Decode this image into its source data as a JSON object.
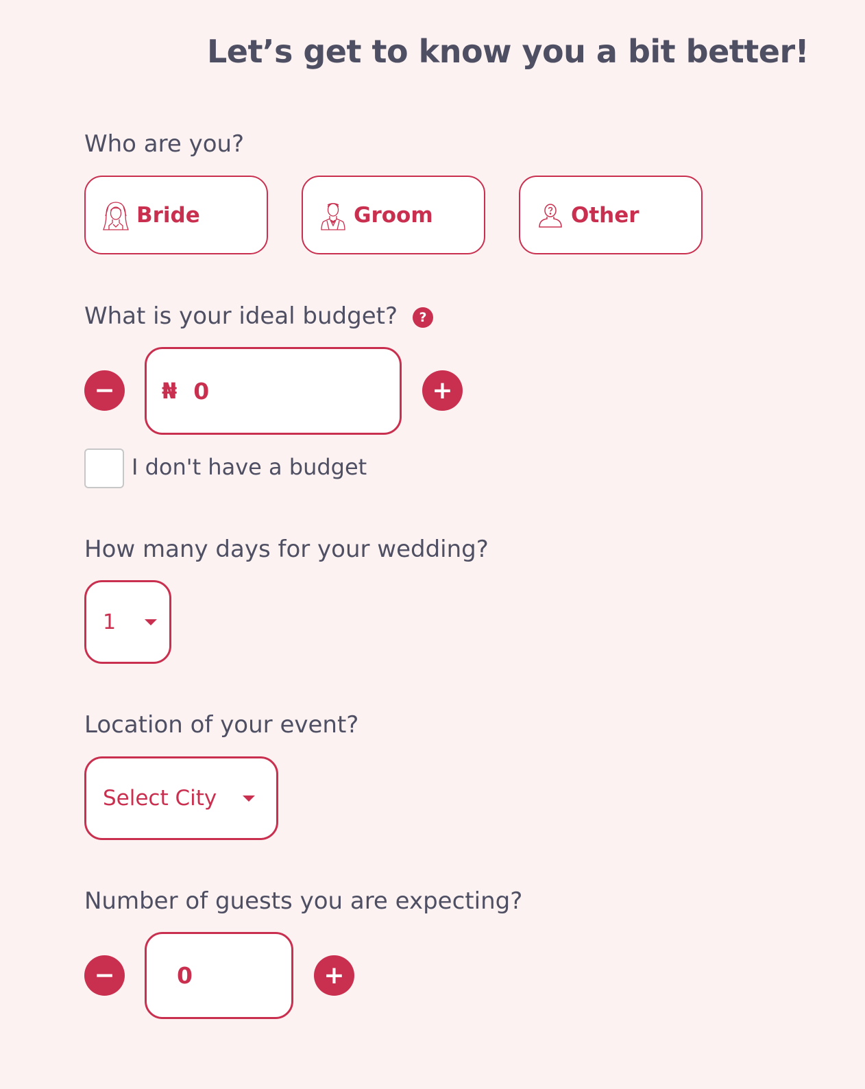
{
  "heading": "Let’s get to know you a bit better!",
  "who": {
    "question": "Who are you?",
    "options": [
      {
        "label": "Bride",
        "icon": "bride-icon"
      },
      {
        "label": "Groom",
        "icon": "groom-icon"
      },
      {
        "label": "Other",
        "icon": "person-question-icon"
      }
    ]
  },
  "budget": {
    "question": "What is your ideal budget?",
    "help_glyph": "?",
    "currency_symbol": "₦",
    "value": "0",
    "decrement_glyph": "−",
    "increment_glyph": "+",
    "no_budget_label": "I don't have a budget",
    "no_budget_checked": false
  },
  "days": {
    "question": "How many days for your wedding?",
    "selected": "1"
  },
  "location": {
    "question": "Location of your event?",
    "placeholder": "Select City"
  },
  "guests": {
    "question": "Number of guests you are expecting?",
    "value": "0",
    "decrement_glyph": "−",
    "increment_glyph": "+"
  },
  "colors": {
    "accent": "#c9304f",
    "text": "#4f4f63",
    "background": "#fbf2f1"
  }
}
